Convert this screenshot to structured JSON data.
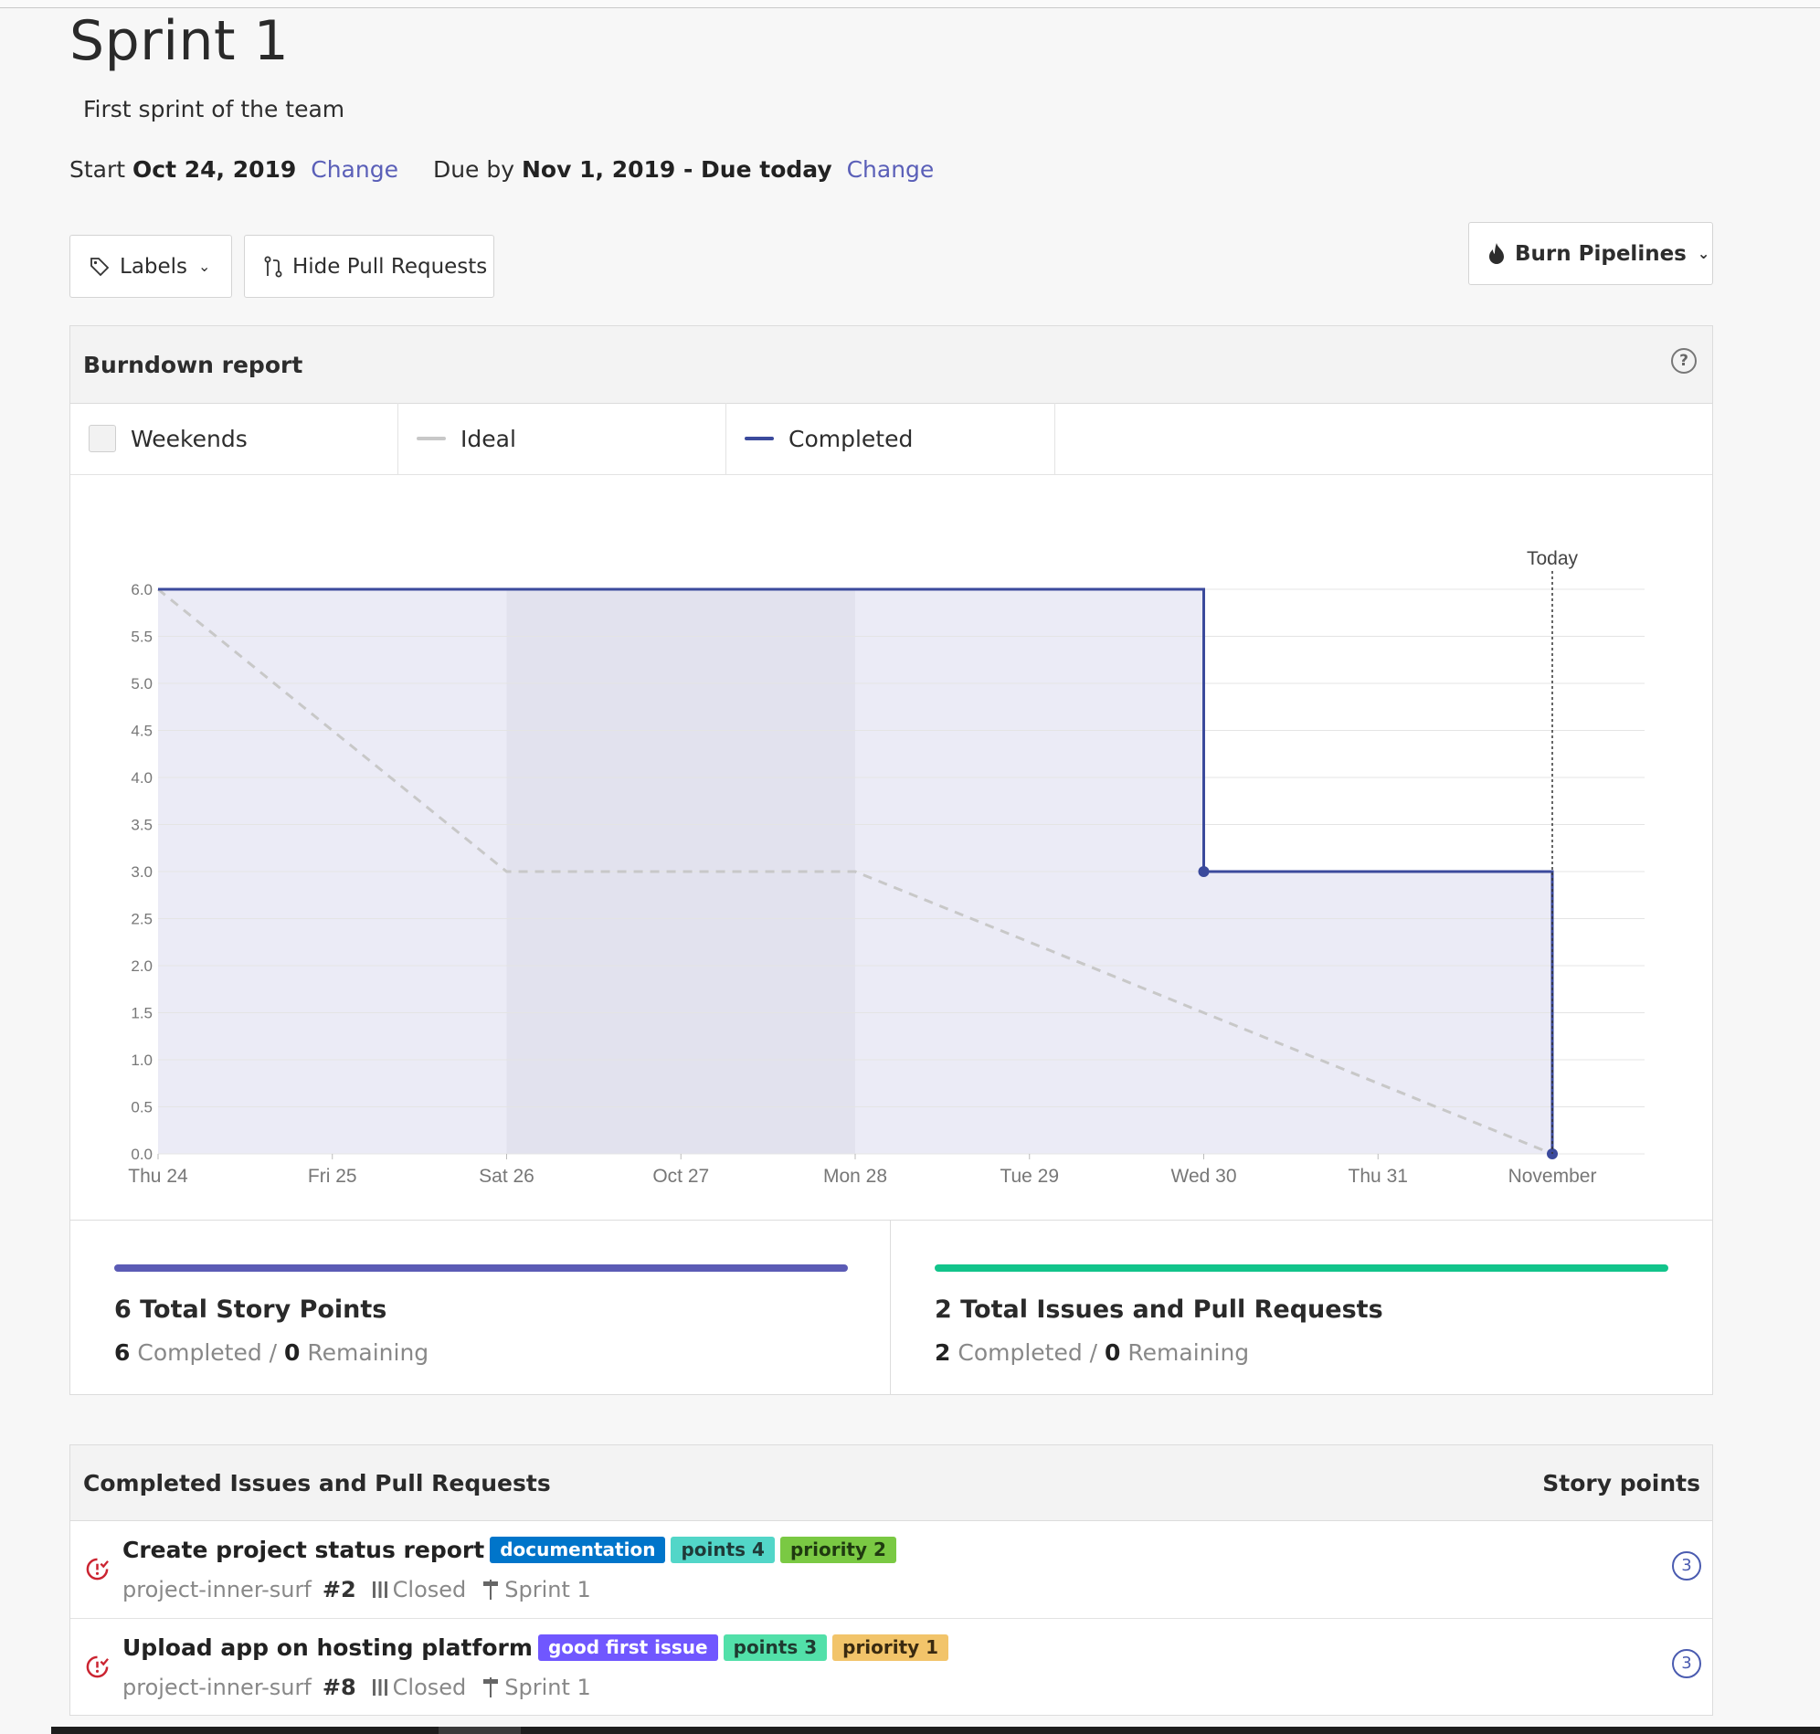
{
  "sprint": {
    "title": "Sprint 1",
    "description": "First sprint of the team",
    "start_label": "Start",
    "start_date": "Oct 24, 2019",
    "change_label": "Change",
    "due_label": "Due by",
    "due_date": "Nov 1, 2019 - Due today",
    "change_label_2": "Change"
  },
  "toolbar": {
    "labels_button": "Labels",
    "hide_pr_button": "Hide Pull Requests",
    "burn_button": "Burn Pipelines"
  },
  "report": {
    "title": "Burndown report",
    "help_glyph": "?",
    "legend": {
      "weekends": "Weekends",
      "ideal": "Ideal",
      "completed": "Completed"
    },
    "today_label": "Today"
  },
  "colors": {
    "completed": "#3b4a9c",
    "ideal": "#c8c8c8",
    "area": "#ebebf6",
    "weekend": "#e2e2ee",
    "story_bar": "#5b5bb5",
    "issues_bar": "#12c48b"
  },
  "chart_data": {
    "type": "line",
    "x": [
      "Thu 24",
      "Fri 25",
      "Sat 26",
      "Oct 27",
      "Mon 28",
      "Tue 29",
      "Wed 30",
      "Thu 31",
      "November"
    ],
    "ylim": [
      0,
      6
    ],
    "yticks": [
      "6.0",
      "5.5",
      "5.0",
      "4.5",
      "4.0",
      "3.5",
      "3.0",
      "2.5",
      "2.0",
      "1.5",
      "1.0",
      "0.5",
      "0.0"
    ],
    "weekend_range": [
      "Sat 26",
      "Mon 28"
    ],
    "series": [
      {
        "name": "Ideal",
        "style": "dashed",
        "points": [
          [
            "Thu 24",
            6
          ],
          [
            "Sat 26",
            3
          ],
          [
            "Mon 28",
            3
          ],
          [
            "November",
            0
          ]
        ]
      },
      {
        "name": "Completed",
        "style": "step",
        "points": [
          [
            "Thu 24",
            6
          ],
          [
            "Wed 30",
            6
          ],
          [
            "Wed 30",
            3
          ],
          [
            "November",
            3
          ],
          [
            "November",
            0
          ]
        ],
        "markers": [
          [
            "Wed 30",
            3
          ],
          [
            "November",
            0
          ]
        ]
      }
    ],
    "today_marker": "November",
    "grid": true
  },
  "stats": {
    "story": {
      "title": "6 Total Story Points",
      "completed_value": "6",
      "completed_label": "Completed /",
      "remaining_value": "0",
      "remaining_label": "Remaining",
      "progress": 1.0
    },
    "issues": {
      "title": "2 Total Issues and Pull Requests",
      "completed_value": "2",
      "completed_label": "Completed /",
      "remaining_value": "0",
      "remaining_label": "Remaining",
      "progress": 1.0
    }
  },
  "table": {
    "header_left": "Completed Issues and Pull Requests",
    "header_right": "Story points",
    "rows": [
      {
        "title": "Create project status report",
        "labels": [
          {
            "text": "documentation",
            "bg": "#0075ca",
            "fg": "#ffffff"
          },
          {
            "text": "points 4",
            "bg": "#52d6c8",
            "fg": "#1f3a38"
          },
          {
            "text": "priority 2",
            "bg": "#7ac943",
            "fg": "#1f3a10"
          }
        ],
        "repo": "project-inner-surf",
        "number": "#2",
        "status": "Closed",
        "milestone": "Sprint 1",
        "points": "3"
      },
      {
        "title": "Upload app on hosting platform",
        "labels": [
          {
            "text": "good first issue",
            "bg": "#7057ff",
            "fg": "#ffffff"
          },
          {
            "text": "points 3",
            "bg": "#52e0a9",
            "fg": "#1f3a30"
          },
          {
            "text": "priority 1",
            "bg": "#f2c46a",
            "fg": "#3a2a10"
          }
        ],
        "repo": "project-inner-surf",
        "number": "#8",
        "status": "Closed",
        "milestone": "Sprint 1",
        "points": "3"
      }
    ]
  }
}
